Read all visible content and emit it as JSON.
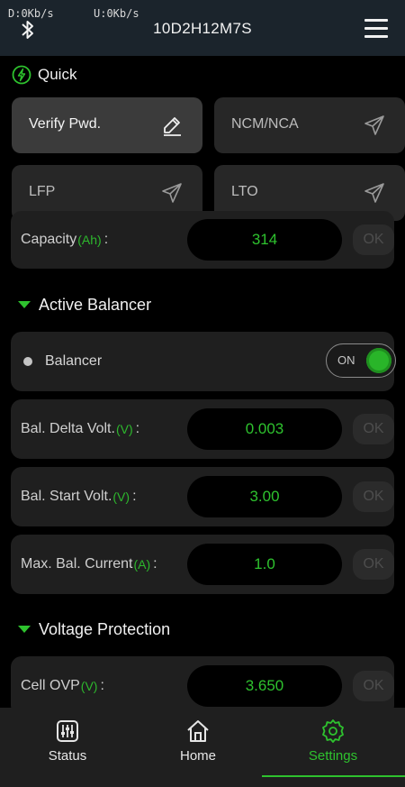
{
  "status_bar": {
    "download_speed": "D:0Kb/s",
    "upload_speed": "U:0Kb/s"
  },
  "header": {
    "device_name": "10D2H12M7S",
    "menu_icon": "hamburger-menu-icon",
    "bluetooth_icon": "bluetooth-icon"
  },
  "quick": {
    "title": "Quick",
    "icon": "lightning-circle-icon",
    "buttons": [
      {
        "label": "Verify Pwd.",
        "icon": "pencil-icon"
      },
      {
        "label": "NCM/NCA",
        "icon": "send-icon"
      },
      {
        "label": "LFP",
        "icon": "send-icon"
      },
      {
        "label": "LTO",
        "icon": "send-icon"
      }
    ]
  },
  "capacity": {
    "label": "Capacity",
    "unit": "(Ah)",
    "colon": ":",
    "value": "314",
    "ok": "OK"
  },
  "active_balancer": {
    "title": "Active Balancer",
    "balancer": {
      "label": "Balancer",
      "toggle_label": "ON"
    },
    "rows": [
      {
        "label": "Bal. Delta Volt.",
        "unit": "(V)",
        "colon": ":",
        "value": "0.003",
        "ok": "OK"
      },
      {
        "label": "Bal. Start Volt.",
        "unit": "(V)",
        "colon": ":",
        "value": "3.00",
        "ok": "OK"
      },
      {
        "label": "Max. Bal. Current",
        "unit": "(A)",
        "colon": ":",
        "value": "1.0",
        "ok": "OK"
      }
    ]
  },
  "voltage_protection": {
    "title": "Voltage Protection",
    "rows": [
      {
        "label": "Cell OVP",
        "unit": "(V)",
        "colon": ":",
        "value": "3.650",
        "ok": "OK"
      }
    ]
  },
  "bottom_nav": {
    "items": [
      {
        "label": "Status",
        "icon": "sliders-icon"
      },
      {
        "label": "Home",
        "icon": "home-icon"
      },
      {
        "label": "Settings",
        "icon": "gear-icon"
      }
    ],
    "selected": "Settings",
    "accent": "#2ec22e"
  },
  "colors": {
    "accent": "#2ec22e",
    "background": "#000000",
    "card": "#1f1f1f",
    "topbar": "#1b242c"
  }
}
